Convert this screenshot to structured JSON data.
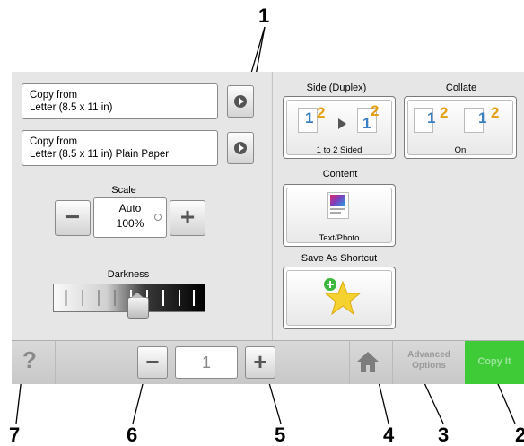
{
  "callouts": [
    "1",
    "2",
    "3",
    "4",
    "5",
    "6",
    "7"
  ],
  "source": {
    "item1_line1": "Copy from",
    "item1_line2": "Letter (8.5 x 11 in)",
    "item2_line1": "Copy from",
    "item2_line2": "Letter (8.5 x 11 in) Plain Paper"
  },
  "scale": {
    "label": "Scale",
    "mode": "Auto",
    "value": "100%"
  },
  "darkness": {
    "label": "Darkness"
  },
  "sides": {
    "label": "Side (Duplex)",
    "value": "1 to 2 Sided"
  },
  "collate": {
    "label": "Collate",
    "value": "On"
  },
  "content": {
    "label": "Content",
    "value": "Text/Photo"
  },
  "shortcut": {
    "label": "Save As Shortcut"
  },
  "bottom": {
    "help": "?",
    "copies": "1",
    "minus": "−",
    "plus": "+",
    "advanced_line1": "Advanced",
    "advanced_line2": "Options",
    "copy_it": "Copy It"
  },
  "icons": [
    "help-icon",
    "minus-icon",
    "plus-icon",
    "home-icon",
    "star-icon",
    "arrow-icon"
  ],
  "colors": {
    "accent_green": "#3fcb38",
    "page_blue": "#3b7fc4",
    "page_orange": "#e3a012"
  }
}
